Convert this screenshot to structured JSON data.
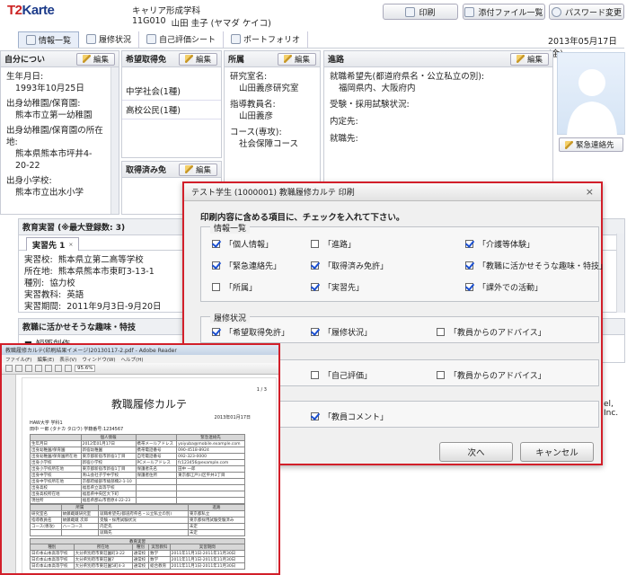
{
  "app": {
    "logo_main": "T2",
    "logo_sub": "Karte"
  },
  "student": {
    "department": "キャリア形成学科",
    "id": "11G010",
    "name": "山田 圭子 (ヤマダ ケイコ)"
  },
  "toolbar": {
    "print": "印刷",
    "attachments": "添付ファイル一覧",
    "password": "パスワード変更"
  },
  "tabs": [
    "情報一覧",
    "履修状況",
    "自己評価シート",
    "ポートフォリオ"
  ],
  "date": "2013年05月17日(金)",
  "edit_label": "編集",
  "self": {
    "title": "自分につい",
    "birth_label": "生年月日:",
    "birth": "1993年10月25日",
    "kinder_label": "出身幼稚園/保育園:",
    "kinder": "熊本市立第一幼稚園",
    "kinder_addr_label": "出身幼稚園/保育園の所在地:",
    "kinder_addr": "熊本県熊本市坪井4-20-22",
    "elem_label": "出身小学校:",
    "elem": "熊本市立出水小学"
  },
  "wish": {
    "title": "希望取得免",
    "items": [
      "中学社会(1種)",
      "高校公民(1種)"
    ]
  },
  "acquired": {
    "title": "取得済み免"
  },
  "affil": {
    "title": "所属",
    "room_label": "研究室名:",
    "room": "山田義彦研究室",
    "advisor_label": "指導教員名:",
    "advisor": "山田義彦",
    "course_label": "コース(専攻):",
    "course": "社会保障コース"
  },
  "career": {
    "title": "進路",
    "wish_label": "就職希望先(都道府県名・公立私立の別):",
    "wish": "福岡県内、大阪府内",
    "exam_label": "受験・採用試験状況:",
    "offer_label": "内定先:",
    "job_label": "就職先:"
  },
  "emergency": "緊急連絡先",
  "practice": {
    "title": "教育実習 (※最大登録数: 3)",
    "tab": "実習先 1",
    "school_label": "実習校:",
    "school": "熊本県立第二高等学校",
    "addr_label": "所在地:",
    "addr": "熊本県熊本市東町3-13-1",
    "type_label": "種別:",
    "type": "協力校",
    "subject_label": "実習教科:",
    "subject": "英語",
    "period_label": "実習期間:",
    "period": "2011年9月3日-9月20日"
  },
  "hobby": {
    "title": "教職に活かせそうな趣味・特技",
    "item": "短距創作"
  },
  "dialog": {
    "title": "テスト学生 (1000001) 教職履修カルテ 印刷",
    "instruction": "印刷内容に含める項目に、チェックを入れて下さい。",
    "group1": "情報一覧",
    "g1": [
      {
        "label": "「個人情報」",
        "on": true
      },
      {
        "label": "「進路」",
        "on": false
      },
      {
        "label": "「介護等体験」",
        "on": true
      },
      {
        "label": "「緊急連絡先」",
        "on": true
      },
      {
        "label": "「取得済み免許」",
        "on": true
      },
      {
        "label": "「教職に活かせそうな趣味・特技」",
        "on": true
      },
      {
        "label": "「所属」",
        "on": false
      },
      {
        "label": "「実習先」",
        "on": true
      },
      {
        "label": "「課外での活動」",
        "on": true
      }
    ],
    "group2": "履修状況",
    "g2": [
      {
        "label": "「希望取得免許」",
        "on": true
      },
      {
        "label": "「履修状況」",
        "on": true
      },
      {
        "label": "「教員からのアドバイス」",
        "on": false
      }
    ],
    "g3": [
      {
        "label": "「自己評価」",
        "on": false
      },
      {
        "label": "「教員からのアドバイス」",
        "on": false
      }
    ],
    "g4": [
      {
        "label": "「教員コメント」",
        "on": true
      }
    ],
    "next": "次へ",
    "cancel": "キャンセル"
  },
  "bg_fragment": "el, Inc.",
  "pdf": {
    "window_title": "教職履修カルテ(印刷結果イメージ)20130117-2.pdf - Adobe Reader",
    "menu": [
      "ファイル(F)",
      "編集(E)",
      "表示(V)",
      "ウィンドウ(W)",
      "ヘルプ(H)"
    ],
    "zoom": "95.6%",
    "page_no": "1 / 3",
    "doc_title": "教職履修カルテ",
    "doc_date": "2013年01月17日",
    "univ": "HAW大学 学科1",
    "person": "田中 一郎 (タナカ タロウ) 学籍番号:1234567",
    "t1_head": [
      "",
      "個人情報",
      "",
      "緊急連絡先"
    ],
    "t1": [
      [
        "生年月日",
        "2012年01月17日",
        "携帯メールアドレス",
        "yoiyuba@mobile.example.com"
      ],
      [
        "出身幼稚園/保育園",
        "新宿幼稚園",
        "携帯電話番号",
        "090-4518-8924"
      ],
      [
        "出身幼稚園/保育園所在地",
        "東京都新宿市新宿1丁目",
        "自宅電話番号",
        "092-323-0000"
      ],
      [
        "出身小学校",
        "新宿小学校",
        "PCメールアドレス",
        "fc123456@example.com"
      ],
      [
        "出身小学校所在地",
        "東京都新宿市新宿1丁目",
        "保護者氏名",
        "田中 一郎"
      ],
      [
        "出身中学校",
        "青山会社子学中学校",
        "保護者住所",
        "東京都江戸川区平井3丁目"
      ],
      [
        "出身中学校所在地",
        "京都府綾部市綾部橋2-1-10",
        "",
        ""
      ],
      [
        "出身高校",
        "福島県立高等学校",
        "",
        ""
      ],
      [
        "出身高校所在地",
        "福島県中央区大下町",
        "",
        ""
      ],
      [
        "現住所",
        "福島県郡山市菅原4-22-23",
        "",
        ""
      ],
      [
        "その他",
        "",
        "",
        ""
      ]
    ],
    "t2_head": [
      "",
      "所属",
      "",
      "進路"
    ],
    "t2": [
      [
        "研究室名",
        "故藤蔵蔵研究室",
        "就職希望先(都道府県名・公立私立の別)",
        "東京都私立"
      ],
      [
        "指導教員名",
        "故藤蔵蔵 次郎",
        "受験・採用試験状況",
        "東京都採用試験受験済み"
      ],
      [
        "コース(専攻)",
        "ハーコース",
        "内定先",
        "未定"
      ],
      [
        "",
        "",
        "就職先",
        "未定"
      ]
    ],
    "t3_title": "教育実習",
    "t3_head": [
      "種別",
      "所在地",
      "種別",
      "実習教科",
      "実習期間"
    ],
    "t3": [
      [
        "日の本山本高等学校",
        "大分県別府市東荘園町3-22",
        "通常校",
        "数学",
        "2011年11月1日-2011年11月30日"
      ],
      [
        "日の本山本高等学校",
        "大分県別府市東荘園7",
        "通常校",
        "数学",
        "2011年11月1日-2011年11月30日"
      ],
      [
        "日の本山本高等学校",
        "大分県別府市東荘園5町4-3",
        "通常校",
        "総合教育",
        "2011年11月1日-2011年11月30日"
      ]
    ]
  }
}
